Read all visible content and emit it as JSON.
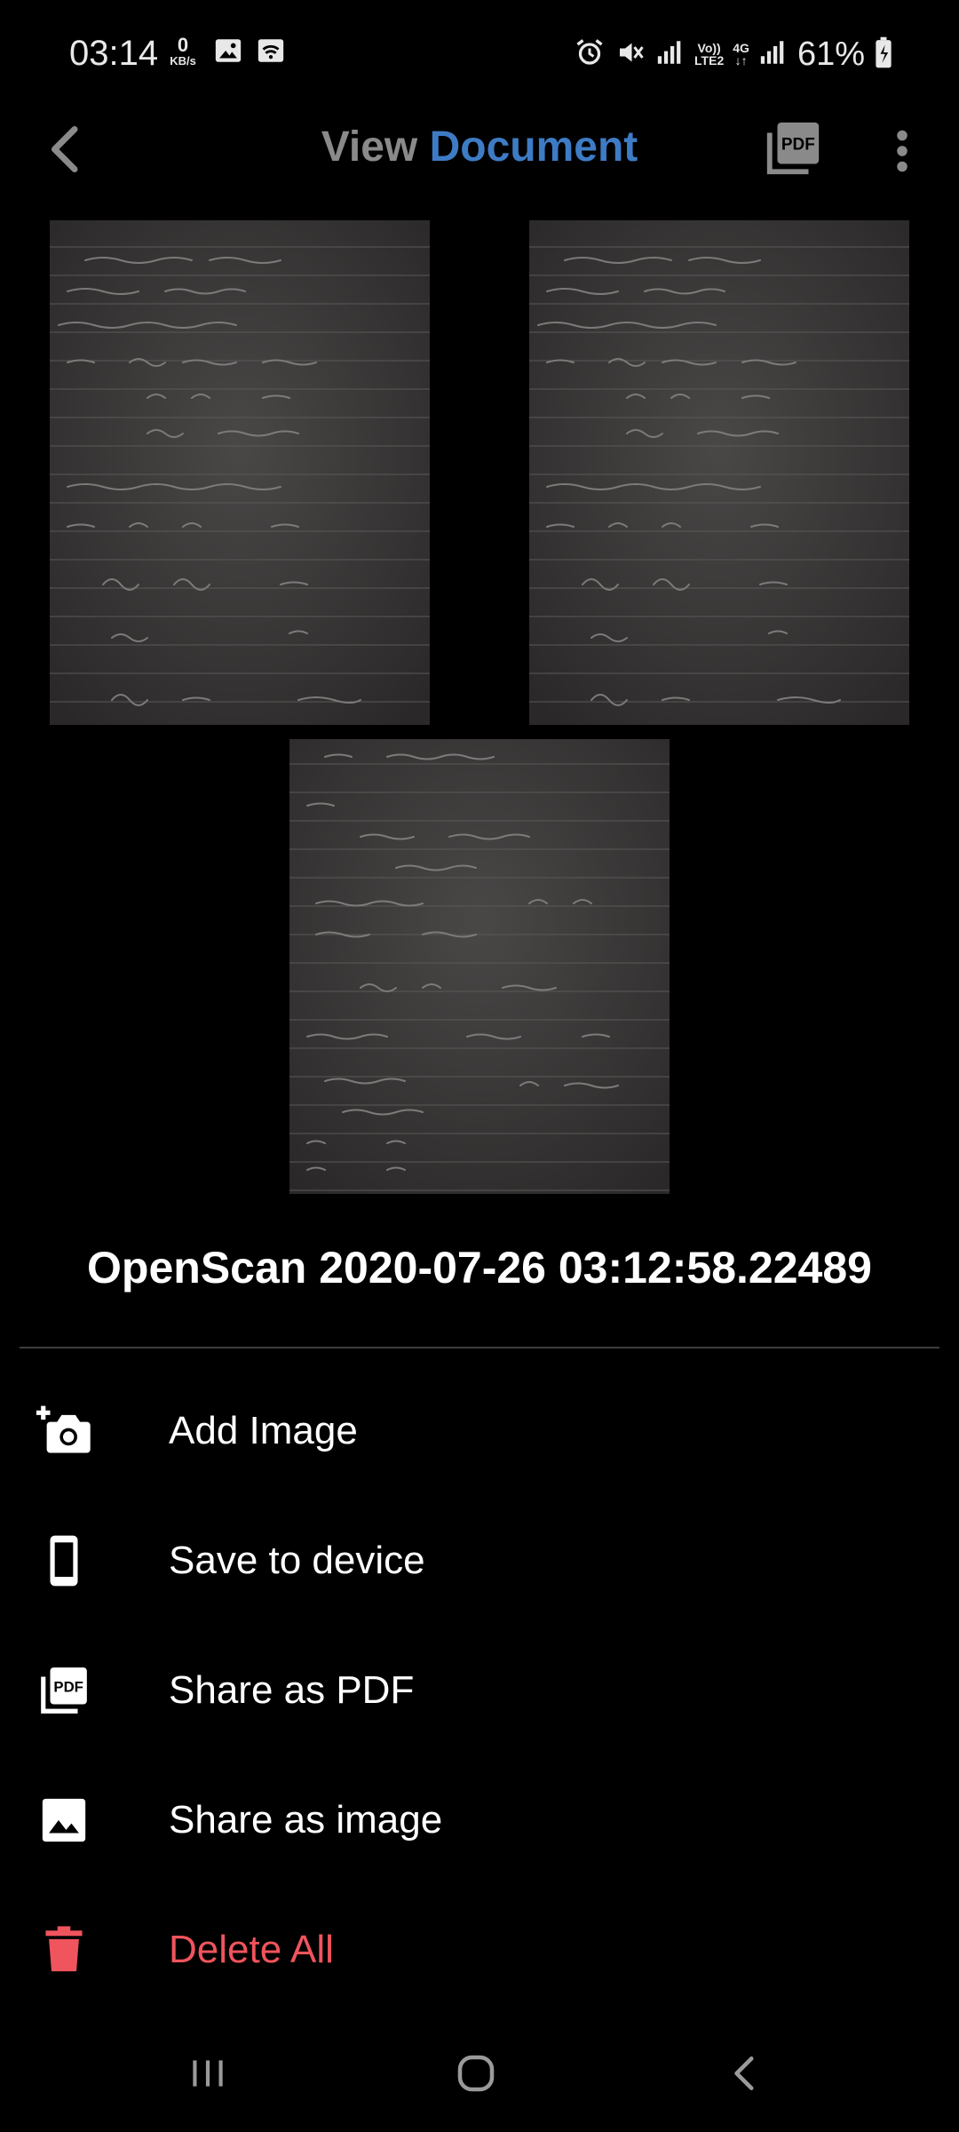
{
  "status_bar": {
    "time": "03:14",
    "net_speed_value": "0",
    "net_speed_unit": "KB/s",
    "volte": "Vo))",
    "lte": "LTE2",
    "network": "4G",
    "battery": "61%"
  },
  "app_bar": {
    "title_part1": "View",
    "title_part2": "Document",
    "colors": {
      "title_muted": "#8a8a8a",
      "title_accent": "#3e7bc5"
    }
  },
  "document": {
    "pages": [
      {
        "label": "page-1"
      },
      {
        "label": "page-2"
      },
      {
        "label": "page-3"
      }
    ]
  },
  "sheet": {
    "title": "OpenScan 2020-07-26 03:12:58.22489",
    "items": [
      {
        "label": "Add Image",
        "icon": "add-camera-icon"
      },
      {
        "label": "Save to device",
        "icon": "phone-icon"
      },
      {
        "label": "Share as PDF",
        "icon": "pdf-icon"
      },
      {
        "label": "Share as image",
        "icon": "image-icon"
      },
      {
        "label": "Delete All",
        "icon": "trash-icon",
        "color": "#f0545c"
      }
    ]
  },
  "nav_bar": {
    "recent": "recent-apps-icon",
    "home": "home-icon",
    "back": "back-icon"
  }
}
